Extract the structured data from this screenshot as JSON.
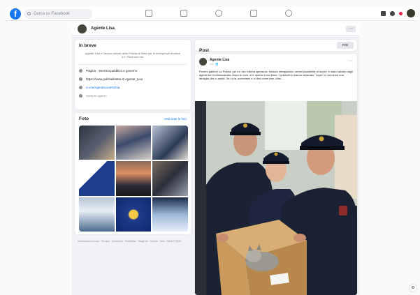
{
  "topbar": {
    "logo": "f",
    "search_placeholder": "Cerca su Facebook",
    "nav_icons": [
      "home-icon",
      "video-icon",
      "marketplace-icon",
      "groups-icon",
      "gaming-icon"
    ],
    "right_icons": [
      "menu-icon",
      "messenger-icon",
      "notifications-icon",
      "account-avatar"
    ]
  },
  "profile": {
    "name": "Agente Lisa",
    "more_label": "···"
  },
  "intro": {
    "title": "In breve",
    "bio": "Agente Lisa è l'amica virtuale della Polizia di Stato per le emergenze emotive 4.0. Parla con me.",
    "rows": [
      {
        "icon": "page-icon",
        "text": "Pagina · Servizio pubblico e governo"
      },
      {
        "icon": "link-icon",
        "text": "https://www.poliziadistato.it/ Agente_Lisa"
      },
      {
        "icon": "messenger-icon",
        "text": "m.me/AgenteLisaPolizia"
      },
      {
        "icon": "globe-icon",
        "text": "Sempre aperto"
      }
    ]
  },
  "photos": {
    "title": "Foto",
    "see_all": "Vedi tutte le foto"
  },
  "footer": "Informazioni sul sito · Privacy · Condizioni · Pubblicità · Scegli tu! · Cookie · Altro · Meta © 2022",
  "posts": {
    "title": "Post",
    "filters_label": "Filtri"
  },
  "post": {
    "author": "Agente Lisa",
    "meta": "4 d · 🌐",
    "text": "Povero gattino! La Polizia, per lui, era l'ultima speranza: rimasto intrappolato, senza possibilità di uscire, è stato salvato dagli agenti del Commissariato. Dopo le cure, si è ripreso e sta bene. I poliziotti lo hanno chiamato \"Lupin\" e ora cerca una famiglia che lo adotti. Se vi va, scrivetemi e vi dirò come fare. Altro..."
  },
  "colors": {
    "brand": "#1877f2",
    "page_bg": "#f0f2f5",
    "text": "#1c1e21",
    "muted": "#65676b"
  }
}
